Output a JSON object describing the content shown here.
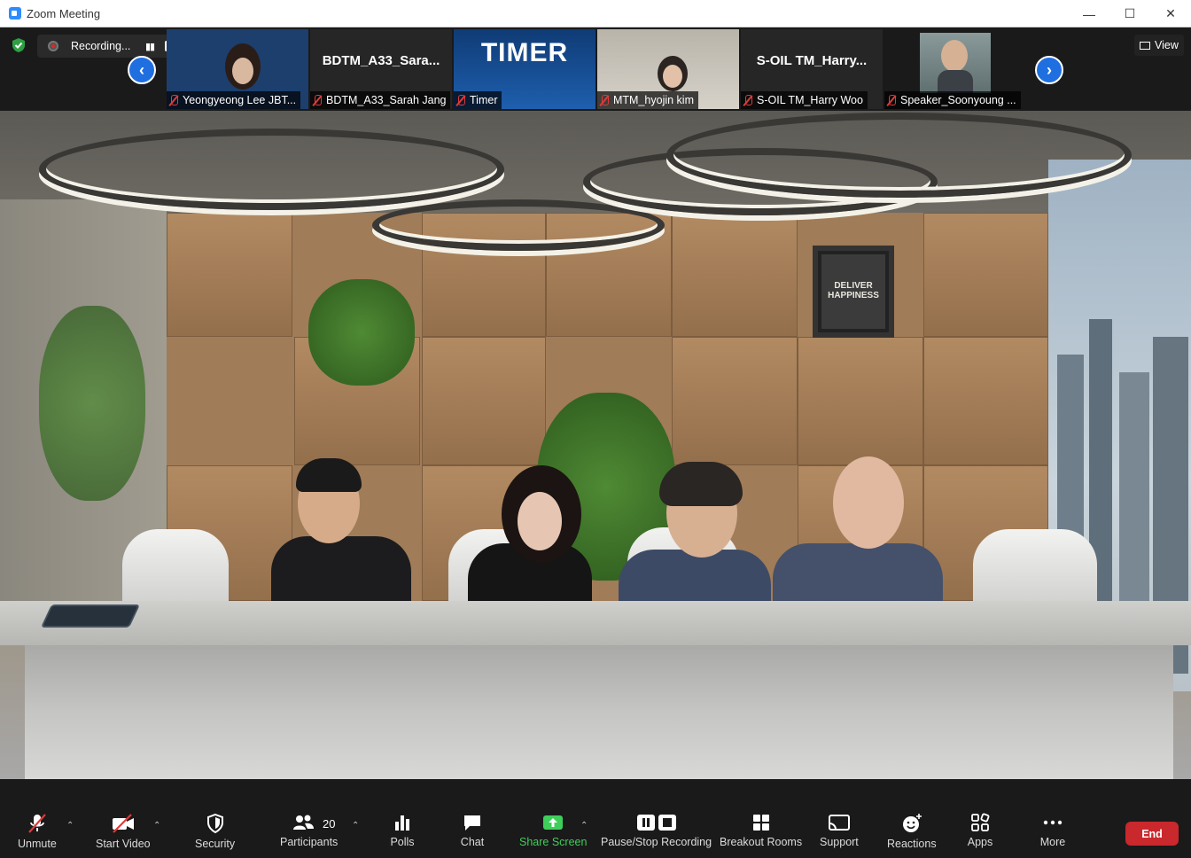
{
  "window": {
    "title": "Zoom Meeting",
    "minimize_glyph": "—",
    "maximize_glyph": "☐",
    "close_glyph": "✕"
  },
  "top_bar": {
    "recording_label": "Recording...",
    "view_label": "View",
    "pause_glyph": "▮▮"
  },
  "nav": {
    "prev_glyph": "‹",
    "next_glyph": "›"
  },
  "participants_strip": [
    {
      "name": "Yeongyeong Lee JBT...",
      "display": "",
      "muted": true
    },
    {
      "name": "BDTM_A33_Sarah Jang",
      "display": "BDTM_A33_Sara...",
      "muted": true
    },
    {
      "name": "Timer",
      "display": "TIMER",
      "muted": true
    },
    {
      "name": "MTM_hyojin kim",
      "display": "",
      "muted": true
    },
    {
      "name": "S-OIL TM_Harry Woo",
      "display": "S-OIL  TM_Harry...",
      "muted": true
    },
    {
      "name": "Speaker_Soonyoung ...",
      "display": "",
      "muted": true
    }
  ],
  "main_video": {
    "poster_text": "DELIVER HAPPINESS"
  },
  "toolbar": {
    "unmute": "Unmute",
    "start_video": "Start Video",
    "security": "Security",
    "participants": "Participants",
    "participant_count": "20",
    "polls": "Polls",
    "chat": "Chat",
    "share_screen": "Share Screen",
    "pause_stop_recording": "Pause/Stop Recording",
    "breakout_rooms": "Breakout Rooms",
    "support": "Support",
    "reactions": "Reactions",
    "apps": "Apps",
    "more": "More",
    "end": "End"
  },
  "colors": {
    "accent_blue": "#1f6fe0",
    "share_green": "#3ecf5a",
    "end_red": "#c9282d",
    "muted_red": "#e03a3a"
  }
}
